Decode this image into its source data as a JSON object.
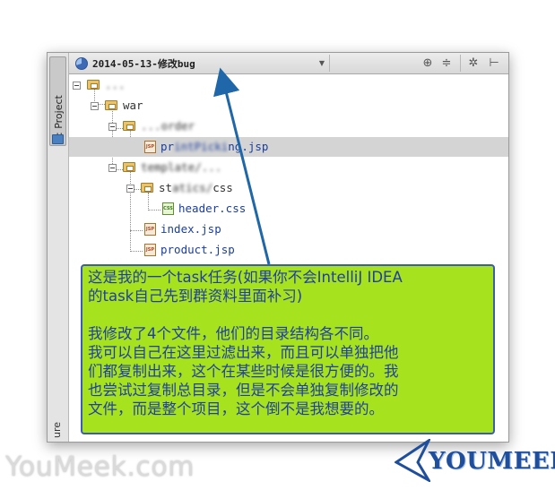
{
  "window": {
    "tool_tab_label": "1: Project",
    "tool_tab_bottom_label": "ure"
  },
  "header": {
    "changelist_name": "2014-05-13-修改bug",
    "buttons": [
      "crosshair-icon",
      "collapse-icon",
      "gear-icon",
      "hide-icon"
    ]
  },
  "tree": {
    "items": [
      {
        "label": "...",
        "blurred": true
      },
      {
        "label": "war",
        "blurred": false
      },
      {
        "label": "...order",
        "blurred": true
      },
      {
        "label_prefix": "pr",
        "label_blur": "intPicki",
        "label_suffix": "ng.jsp"
      },
      {
        "label": "template/...",
        "blurred": true
      },
      {
        "label_prefix": "st",
        "label_blur": "atics/",
        "label_suffix": "css"
      },
      {
        "label": "header.css"
      },
      {
        "label": "index.jsp"
      },
      {
        "label": "product.jsp"
      }
    ]
  },
  "callout": {
    "line1": "这是我的一个task任务(如果你不会IntelliJ IDEA",
    "line2": "的task自己先到群资料里面补习)",
    "line3": "我修改了4个文件，他们的目录结构各不同。",
    "line4": "我可以自己在这里过滤出来，而且可以单独把他",
    "line5": "们都复制出来，这个在某些时候是很方便的。我",
    "line6": "也尝试过复制总目录，但是不会单独复制修改的",
    "line7": "文件，而是整个项目，这个倒不是我想要的。"
  },
  "watermark": "YouMeek.com",
  "brand": "YOUMEEK",
  "colors": {
    "callout_bg": "#a6e21d",
    "callout_text": "#1f3fa5",
    "arrow": "#1f67a8",
    "file_label_blue": "#1a3e9c"
  }
}
